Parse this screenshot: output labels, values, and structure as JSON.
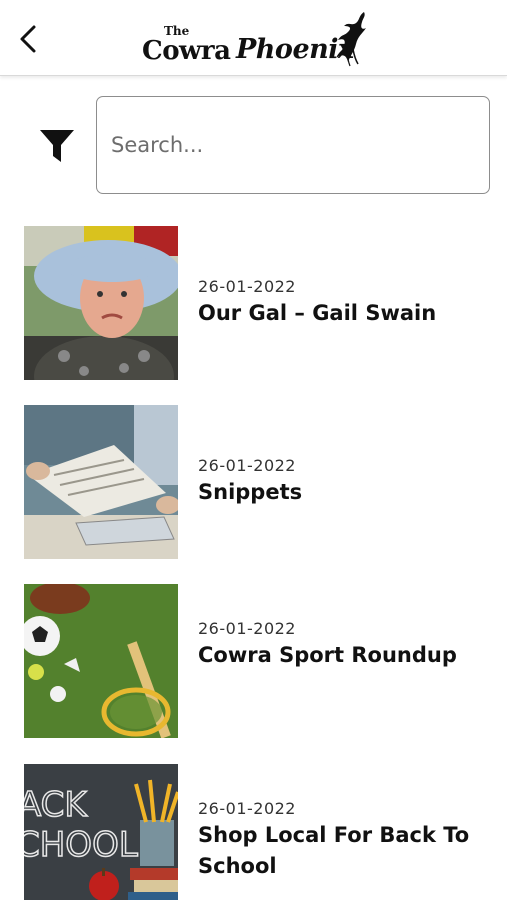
{
  "header": {
    "logo_small": "The",
    "logo_main": "Cowra",
    "logo_script": "Phoenix",
    "back_icon": "chevron-left-icon"
  },
  "search": {
    "placeholder": "Search...",
    "value": "",
    "filter_icon": "filter-funnel-icon"
  },
  "articles": [
    {
      "date": "26-01-2022",
      "title": "Our Gal – Gail Swain",
      "thumbnail": "woman-in-hat-photo"
    },
    {
      "date": "26-01-2022",
      "title": "Snippets",
      "thumbnail": "newspaper-reading-photo"
    },
    {
      "date": "26-01-2022",
      "title": "Cowra Sport Roundup",
      "thumbnail": "sports-equipment-photo"
    },
    {
      "date": "26-01-2022",
      "title": "Shop Local For Back To School",
      "thumbnail": "back-to-school-chalkboard-photo"
    }
  ],
  "colors": {
    "text": "#111111",
    "border": "#8d8d8d",
    "header_border": "#d9d9d9"
  }
}
